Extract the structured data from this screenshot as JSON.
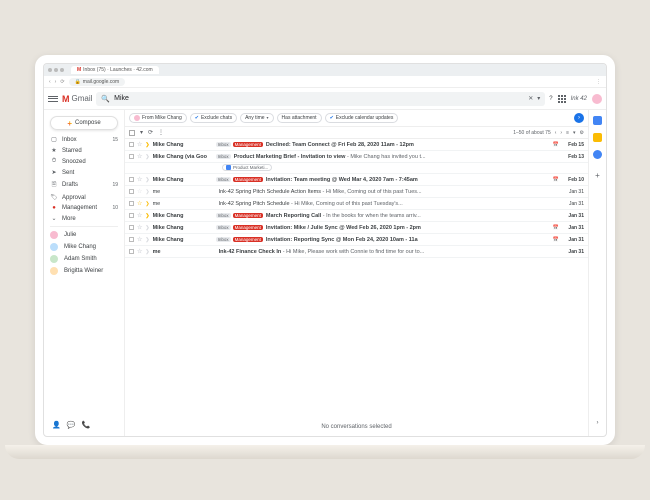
{
  "browser": {
    "tab_title": "Inbox (75) · Launches · 42.com",
    "url": "mail.google.com"
  },
  "header": {
    "product": "Gmail",
    "search_value": "Mike",
    "profile_name": "Ink 42"
  },
  "compose": {
    "label": "Compose"
  },
  "sidebar": {
    "items": [
      {
        "icon": "inbox",
        "label": "Inbox",
        "count": "15"
      },
      {
        "icon": "star",
        "label": "Starred",
        "count": ""
      },
      {
        "icon": "clock",
        "label": "Snoozed",
        "count": ""
      },
      {
        "icon": "send",
        "label": "Sent",
        "count": ""
      },
      {
        "icon": "file",
        "label": "Drafts",
        "count": "19"
      },
      {
        "icon": "tag",
        "label": "Approval",
        "count": ""
      },
      {
        "icon": "red",
        "label": "Management",
        "count": "10"
      },
      {
        "icon": "more",
        "label": "More",
        "count": ""
      }
    ],
    "contacts": [
      {
        "name": "Julie"
      },
      {
        "name": "Mike Chang"
      },
      {
        "name": "Adam Smith"
      },
      {
        "name": "Brigitta Weiner"
      }
    ]
  },
  "chips": [
    {
      "label": "From Mike Chang",
      "avatar": true
    },
    {
      "label": "Exclude chats",
      "check": true
    },
    {
      "label": "Any time",
      "dropdown": true
    },
    {
      "label": "Has attachment"
    },
    {
      "label": "Exclude calendar updates",
      "check": true
    }
  ],
  "toolbar": {
    "pagination": "1–50 of about 75"
  },
  "emails": [
    {
      "sender": "Mike Chang",
      "unread": true,
      "star": false,
      "important": true,
      "labels": [
        "inbox",
        "mgmt"
      ],
      "subject": "Declined: Team Connect @ Fri Feb 28, 2020 11am - 12pm",
      "snippet": "",
      "date": "Feb 15",
      "cal": true
    },
    {
      "sender": "Mike Chang (via Goo",
      "unread": true,
      "star": false,
      "important": false,
      "labels": [
        "inbox"
      ],
      "subject": "Product Marketing Brief - Invitation to view",
      "snippet": " - Mike Chang has invited you t...",
      "date": "Feb 13",
      "attachment": "Product Marketi..."
    },
    {
      "sender": "Mike Chang",
      "unread": true,
      "star": false,
      "important": false,
      "labels": [
        "inbox",
        "mgmt"
      ],
      "subject": "Invitation: Team meeting @ Wed Mar 4, 2020 7am - 7:45am",
      "snippet": "",
      "date": "Feb 10",
      "cal": true
    },
    {
      "sender": "me",
      "unread": false,
      "star": false,
      "important": false,
      "labels": [],
      "subject": "Ink-42 Spring Pitch Schedule Action Items",
      "snippet": " - Hi Mike, Coming out of this past Tues...",
      "date": "Jan 31"
    },
    {
      "sender": "me",
      "unread": false,
      "star": true,
      "important": true,
      "labels": [],
      "subject": "Ink-42 Spring Pitch Schedule",
      "snippet": " - Hi Mike, Coming out of this past Tuesday's...",
      "date": "Jan 31"
    },
    {
      "sender": "Mike Chang",
      "unread": true,
      "star": false,
      "important": true,
      "labels": [
        "inbox",
        "mgmt"
      ],
      "subject": "March Reporting Call",
      "snippet": " - In the books for when the teams arriv...",
      "date": "Jan 31"
    },
    {
      "sender": "Mike Chang",
      "unread": true,
      "star": false,
      "important": false,
      "labels": [
        "inbox",
        "mgmt"
      ],
      "subject": "Invitation: Mike / Julie Sync @ Wed Feb 26, 2020 1pm - 2pm",
      "snippet": "",
      "date": "Jan 31",
      "cal": true
    },
    {
      "sender": "Mike Chang",
      "unread": true,
      "star": false,
      "important": false,
      "labels": [
        "inbox",
        "mgmt"
      ],
      "subject": "Invitation: Reporting Sync @ Mon Feb 24, 2020 10am - 11a",
      "snippet": "",
      "date": "Jan 31",
      "cal": true
    },
    {
      "sender": "me",
      "unread": true,
      "star": false,
      "important": false,
      "labels": [],
      "subject": "Ink-42 Finance Check In",
      "snippet": " - Hi Mike, Please work with Connie to find time for our to...",
      "date": "Jan 31"
    }
  ],
  "footer": {
    "no_conv": "No conversations selected"
  }
}
